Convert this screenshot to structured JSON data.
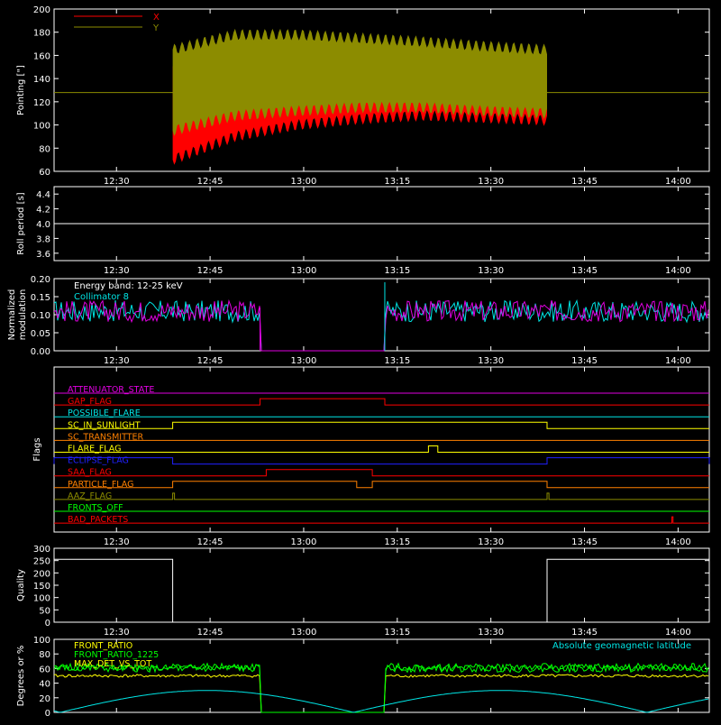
{
  "time_ticks": [
    "12:30",
    "12:45",
    "13:00",
    "13:15",
    "13:30",
    "13:45",
    "14:00"
  ],
  "colors": {
    "background": "#000000",
    "axes": "#ffffff",
    "red": "#ff0000",
    "olive": "#8c8c00",
    "cyan": "#00e5e5",
    "magenta": "#e000e0",
    "yellow": "#ffff00",
    "green": "#00ff00",
    "blue": "#2020ff",
    "orange": "#ff8000"
  },
  "chart_data": [
    {
      "id": "pointing",
      "type": "line",
      "ylabel": "Pointing [\"]",
      "ylim": [
        60,
        200
      ],
      "yticks": [
        "60",
        "80",
        "100",
        "120",
        "140",
        "160",
        "180",
        "200"
      ],
      "legend": [
        "X",
        "Y"
      ],
      "series": [
        {
          "name": "X",
          "color": "#ff0000",
          "time_range": [
            "12:39",
            "13:39"
          ],
          "envelope_upper": [
            150,
            165,
            172,
            170,
            168,
            165,
            163
          ],
          "envelope_lower": [
            70,
            90,
            100,
            105,
            108,
            106,
            104
          ]
        },
        {
          "name": "Y",
          "color": "#8c8c00",
          "time_range": [
            "12:39",
            "13:39"
          ],
          "envelope_upper": [
            165,
            178,
            178,
            175,
            172,
            168,
            165
          ],
          "envelope_lower": [
            95,
            108,
            112,
            115,
            115,
            112,
            110
          ]
        }
      ],
      "reference_line": 128
    },
    {
      "id": "roll",
      "type": "line",
      "ylabel": "Roll period [s]",
      "ylim": [
        3.5,
        4.5
      ],
      "yticks": [
        "3.6",
        "3.8",
        "4.0",
        "4.2",
        "4.4"
      ],
      "constant_value": 4.0
    },
    {
      "id": "modulation",
      "type": "line",
      "ylabel": "Normalized modulation",
      "ylim": [
        0.0,
        0.2
      ],
      "yticks": [
        "0.00",
        "0.05",
        "0.10",
        "0.15",
        "0.20"
      ],
      "annotations": [
        "Energy band: 12-25 keV",
        "Collimator 8"
      ],
      "series": [
        {
          "name": "Energy band: 12-25 keV",
          "color": "#e000e0",
          "typical": 0.11
        },
        {
          "name": "Collimator 8",
          "color": "#00e5e5",
          "typical": 0.11
        }
      ],
      "gap": [
        "12:53",
        "13:13"
      ]
    },
    {
      "id": "flags",
      "type": "line",
      "ylabel": "Flags",
      "flags": [
        {
          "label": "ATTENUATOR_STATE",
          "color": "#e000e0",
          "on": []
        },
        {
          "label": "GAP_FLAG",
          "color": "#ff0000",
          "on": [
            [
              "12:53",
              "13:13"
            ]
          ]
        },
        {
          "label": "POSSIBLE_FLARE",
          "color": "#00e5e5",
          "on": []
        },
        {
          "label": "SC_IN_SUNLIGHT",
          "color": "#ffff00",
          "on": [
            [
              "12:39",
              "13:39"
            ]
          ]
        },
        {
          "label": "SC_TRANSMITTER",
          "color": "#ff8000",
          "on": []
        },
        {
          "label": "FLARE_FLAG",
          "color": "#ffff00",
          "on": [
            [
              "13:20",
              "13:21.5"
            ]
          ]
        },
        {
          "label": "ECLIPSE_FLAG",
          "color": "#2020ff",
          "on": [
            [
              "12:20",
              "12:39"
            ],
            [
              "13:39",
              "14:05"
            ]
          ]
        },
        {
          "label": "SAA_FLAG",
          "color": "#ff0000",
          "on": [
            [
              "12:54",
              "13:11"
            ]
          ]
        },
        {
          "label": "PARTICLE_FLAG",
          "color": "#ff8000",
          "on": [
            [
              "12:39",
              "13:08.5"
            ],
            [
              "13:11",
              "13:39"
            ]
          ]
        },
        {
          "label": "AAZ_FLAG",
          "color": "#8c8c00",
          "on": [
            [
              "12:39",
              "12:39.3"
            ],
            [
              "13:39",
              "13:39.3"
            ]
          ]
        },
        {
          "label": "FRONTS_OFF",
          "color": "#00ff00",
          "on": []
        },
        {
          "label": "BAD_PACKETS",
          "color": "#ff0000",
          "on": [
            [
              "13:59",
              "13:59.2"
            ]
          ]
        }
      ]
    },
    {
      "id": "quality",
      "type": "line",
      "ylabel": "Quality",
      "ylim": [
        0,
        300
      ],
      "yticks": [
        "0",
        "50",
        "100",
        "150",
        "200",
        "250",
        "300"
      ],
      "segments": [
        {
          "from": "12:20",
          "to": "12:39",
          "value": 255
        },
        {
          "from": "12:39",
          "to": "13:39",
          "value": 0
        },
        {
          "from": "13:39",
          "to": "14:05",
          "value": 255
        }
      ]
    },
    {
      "id": "degrees",
      "type": "line",
      "ylabel": "Degrees or %",
      "ylim": [
        0,
        100
      ],
      "yticks": [
        "0",
        "20",
        "40",
        "60",
        "80",
        "100"
      ],
      "legend": [
        "FRONT_RATIO",
        "FRONT_RATIO_1225",
        "MAX_DET_VS_TOT"
      ],
      "annotation": "Absolute geomagnetic latitude",
      "series": [
        {
          "name": "FRONT_RATIO",
          "color": "#00ff00",
          "typical": 62
        },
        {
          "name": "FRONT_RATIO_1225",
          "color": "#00ff00",
          "typical": 60
        },
        {
          "name": "MAX_DET_VS_TOT",
          "color": "#ffff00",
          "typical": 50
        },
        {
          "name": "Absolute geomagnetic latitude",
          "color": "#00e5e5",
          "peak": 30
        }
      ],
      "gap": [
        "12:53",
        "13:13"
      ]
    }
  ]
}
